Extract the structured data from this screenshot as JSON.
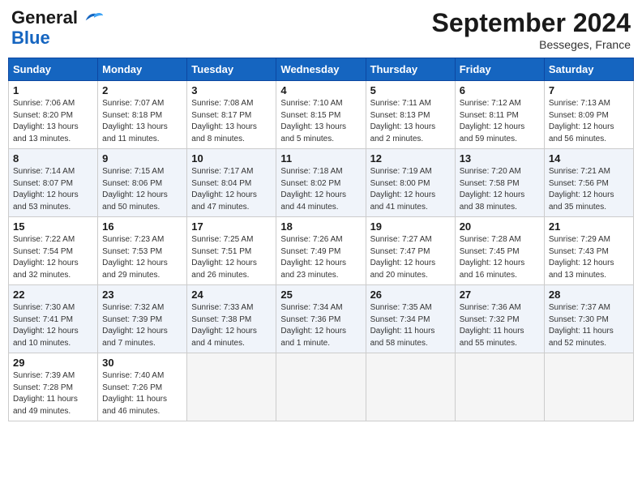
{
  "header": {
    "logo_line1": "General",
    "logo_line2": "Blue",
    "month": "September 2024",
    "location": "Besseges, France"
  },
  "weekdays": [
    "Sunday",
    "Monday",
    "Tuesday",
    "Wednesday",
    "Thursday",
    "Friday",
    "Saturday"
  ],
  "weeks": [
    [
      {
        "day": "1",
        "info": "Sunrise: 7:06 AM\nSunset: 8:20 PM\nDaylight: 13 hours\nand 13 minutes."
      },
      {
        "day": "2",
        "info": "Sunrise: 7:07 AM\nSunset: 8:18 PM\nDaylight: 13 hours\nand 11 minutes."
      },
      {
        "day": "3",
        "info": "Sunrise: 7:08 AM\nSunset: 8:17 PM\nDaylight: 13 hours\nand 8 minutes."
      },
      {
        "day": "4",
        "info": "Sunrise: 7:10 AM\nSunset: 8:15 PM\nDaylight: 13 hours\nand 5 minutes."
      },
      {
        "day": "5",
        "info": "Sunrise: 7:11 AM\nSunset: 8:13 PM\nDaylight: 13 hours\nand 2 minutes."
      },
      {
        "day": "6",
        "info": "Sunrise: 7:12 AM\nSunset: 8:11 PM\nDaylight: 12 hours\nand 59 minutes."
      },
      {
        "day": "7",
        "info": "Sunrise: 7:13 AM\nSunset: 8:09 PM\nDaylight: 12 hours\nand 56 minutes."
      }
    ],
    [
      {
        "day": "8",
        "info": "Sunrise: 7:14 AM\nSunset: 8:07 PM\nDaylight: 12 hours\nand 53 minutes."
      },
      {
        "day": "9",
        "info": "Sunrise: 7:15 AM\nSunset: 8:06 PM\nDaylight: 12 hours\nand 50 minutes."
      },
      {
        "day": "10",
        "info": "Sunrise: 7:17 AM\nSunset: 8:04 PM\nDaylight: 12 hours\nand 47 minutes."
      },
      {
        "day": "11",
        "info": "Sunrise: 7:18 AM\nSunset: 8:02 PM\nDaylight: 12 hours\nand 44 minutes."
      },
      {
        "day": "12",
        "info": "Sunrise: 7:19 AM\nSunset: 8:00 PM\nDaylight: 12 hours\nand 41 minutes."
      },
      {
        "day": "13",
        "info": "Sunrise: 7:20 AM\nSunset: 7:58 PM\nDaylight: 12 hours\nand 38 minutes."
      },
      {
        "day": "14",
        "info": "Sunrise: 7:21 AM\nSunset: 7:56 PM\nDaylight: 12 hours\nand 35 minutes."
      }
    ],
    [
      {
        "day": "15",
        "info": "Sunrise: 7:22 AM\nSunset: 7:54 PM\nDaylight: 12 hours\nand 32 minutes."
      },
      {
        "day": "16",
        "info": "Sunrise: 7:23 AM\nSunset: 7:53 PM\nDaylight: 12 hours\nand 29 minutes."
      },
      {
        "day": "17",
        "info": "Sunrise: 7:25 AM\nSunset: 7:51 PM\nDaylight: 12 hours\nand 26 minutes."
      },
      {
        "day": "18",
        "info": "Sunrise: 7:26 AM\nSunset: 7:49 PM\nDaylight: 12 hours\nand 23 minutes."
      },
      {
        "day": "19",
        "info": "Sunrise: 7:27 AM\nSunset: 7:47 PM\nDaylight: 12 hours\nand 20 minutes."
      },
      {
        "day": "20",
        "info": "Sunrise: 7:28 AM\nSunset: 7:45 PM\nDaylight: 12 hours\nand 16 minutes."
      },
      {
        "day": "21",
        "info": "Sunrise: 7:29 AM\nSunset: 7:43 PM\nDaylight: 12 hours\nand 13 minutes."
      }
    ],
    [
      {
        "day": "22",
        "info": "Sunrise: 7:30 AM\nSunset: 7:41 PM\nDaylight: 12 hours\nand 10 minutes."
      },
      {
        "day": "23",
        "info": "Sunrise: 7:32 AM\nSunset: 7:39 PM\nDaylight: 12 hours\nand 7 minutes."
      },
      {
        "day": "24",
        "info": "Sunrise: 7:33 AM\nSunset: 7:38 PM\nDaylight: 12 hours\nand 4 minutes."
      },
      {
        "day": "25",
        "info": "Sunrise: 7:34 AM\nSunset: 7:36 PM\nDaylight: 12 hours\nand 1 minute."
      },
      {
        "day": "26",
        "info": "Sunrise: 7:35 AM\nSunset: 7:34 PM\nDaylight: 11 hours\nand 58 minutes."
      },
      {
        "day": "27",
        "info": "Sunrise: 7:36 AM\nSunset: 7:32 PM\nDaylight: 11 hours\nand 55 minutes."
      },
      {
        "day": "28",
        "info": "Sunrise: 7:37 AM\nSunset: 7:30 PM\nDaylight: 11 hours\nand 52 minutes."
      }
    ],
    [
      {
        "day": "29",
        "info": "Sunrise: 7:39 AM\nSunset: 7:28 PM\nDaylight: 11 hours\nand 49 minutes."
      },
      {
        "day": "30",
        "info": "Sunrise: 7:40 AM\nSunset: 7:26 PM\nDaylight: 11 hours\nand 46 minutes."
      },
      {
        "day": "",
        "info": ""
      },
      {
        "day": "",
        "info": ""
      },
      {
        "day": "",
        "info": ""
      },
      {
        "day": "",
        "info": ""
      },
      {
        "day": "",
        "info": ""
      }
    ]
  ]
}
